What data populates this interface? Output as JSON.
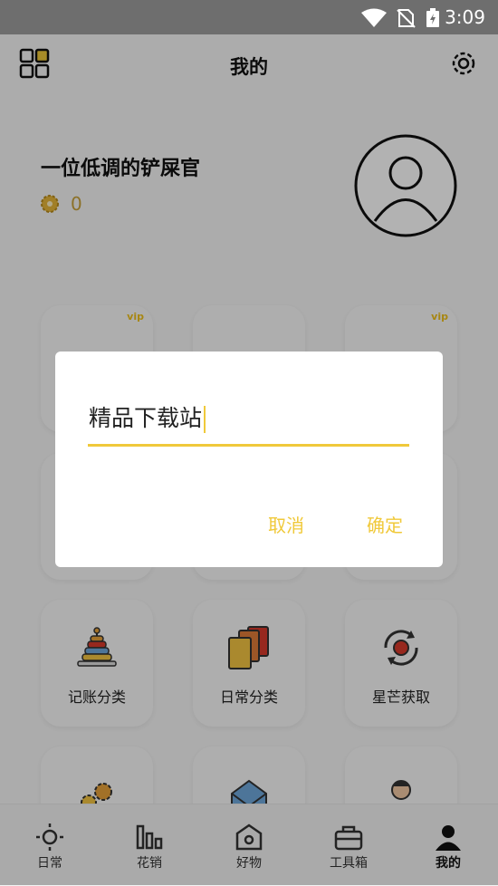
{
  "status_bar": {
    "time": "3:09"
  },
  "app_bar": {
    "title": "我的"
  },
  "profile": {
    "username": "一位低调的铲屎官",
    "coins": "0"
  },
  "grid_cards": {
    "vip_tag": "vip",
    "row3": [
      {
        "label": "记账分类"
      },
      {
        "label": "日常分类"
      },
      {
        "label": "星芒获取"
      }
    ]
  },
  "tabs": [
    {
      "label": "日常"
    },
    {
      "label": "花销"
    },
    {
      "label": "好物"
    },
    {
      "label": "工具箱"
    },
    {
      "label": "我的"
    }
  ],
  "dialog": {
    "input_value": "精品下载站",
    "cancel_label": "取消",
    "confirm_label": "确定"
  },
  "colors": {
    "accent": "#f0c93a",
    "status_bar": "#6e6e6e"
  }
}
